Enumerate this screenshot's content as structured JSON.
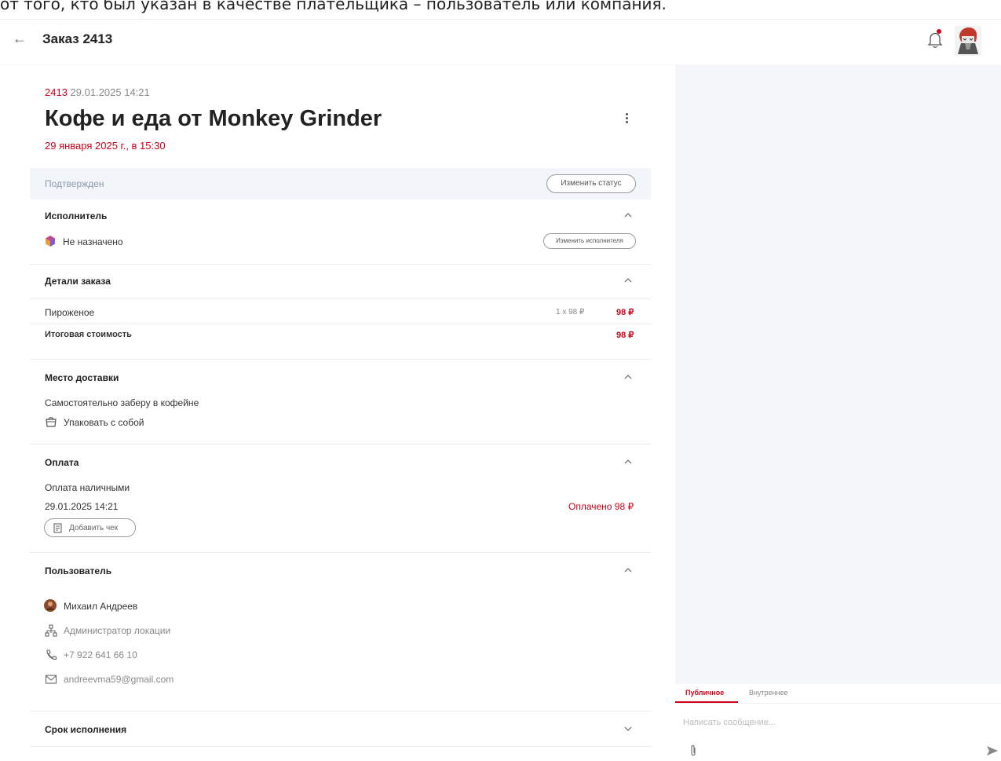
{
  "caption": "от того, кто был указан в качестве плательщика – пользователь или компания.",
  "header": {
    "back_icon": "arrow-left-icon",
    "title": "Заказ 2413",
    "bell_icon": "bell-icon",
    "notification_dot_color": "#d0021b"
  },
  "order": {
    "number": "2413",
    "created": "29.01.2025 14:21",
    "title": "Кофе и еда от Monkey Grinder",
    "delivery_date": "29 января 2025 г., в 15:30"
  },
  "status": {
    "label": "Подтвержден",
    "change_button": "Изменить статус"
  },
  "executor": {
    "heading": "Исполнитель",
    "value": "Не назначено",
    "change_button": "Изменить исполнителя"
  },
  "details": {
    "heading": "Детали заказа",
    "items": [
      {
        "name": "Пироженое",
        "qty": "1 x 98 ₽",
        "price": "98 ₽"
      }
    ],
    "total_label": "Итоговая стоимость",
    "total_value": "98 ₽"
  },
  "delivery": {
    "heading": "Место доставки",
    "method": "Самостоятельно заберу в кофейне",
    "pack": "Упаковать с собой"
  },
  "payment": {
    "heading": "Оплата",
    "method": "Оплата наличными",
    "date": "29.01.2025 14:21",
    "status": "Оплачено 98 ₽",
    "add_receipt": "Добавить чек"
  },
  "user": {
    "heading": "Пользователь",
    "name": "Михаил Андреев",
    "role": "Администратор локации",
    "phone": "+7 922 641 66 10",
    "email": "andreevma59@gmail.com"
  },
  "deadline": {
    "heading": "Срок исполнения"
  },
  "chat": {
    "tab_public": "Публичное",
    "tab_internal": "Внутреннее",
    "placeholder": "Написать сообщение..."
  },
  "colors": {
    "accent": "#d0021b",
    "status_bg": "#f2f5f9",
    "right_panel_bg": "#f4f6fa"
  }
}
